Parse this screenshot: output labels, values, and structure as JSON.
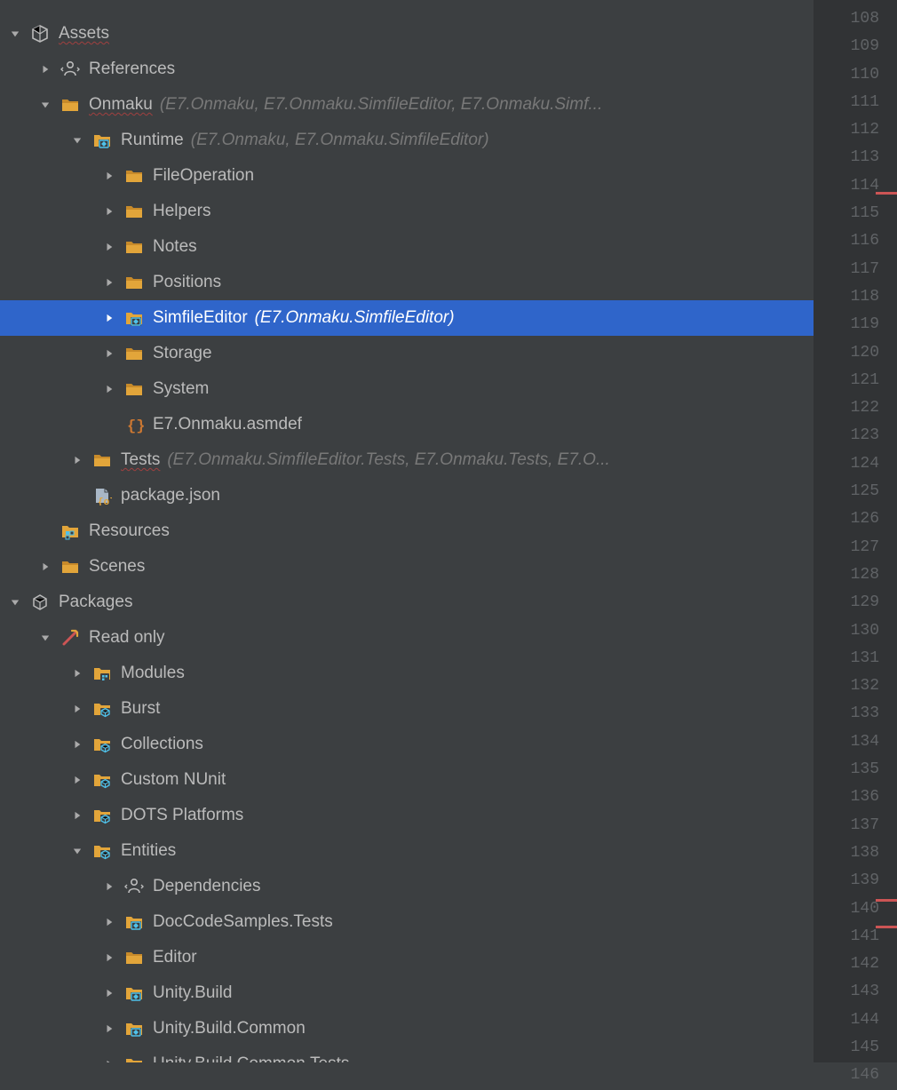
{
  "gutter": {
    "start": 108,
    "end": 146,
    "marks": [
      216,
      1012,
      1042
    ]
  },
  "tree": [
    {
      "indent": 0,
      "arrow": "expanded",
      "icon": "unity",
      "label": "Assets",
      "labelStyle": "excluded",
      "hint": ""
    },
    {
      "indent": 1,
      "arrow": "collapsed",
      "icon": "references",
      "label": "References",
      "hint": ""
    },
    {
      "indent": 1,
      "arrow": "expanded",
      "icon": "folder",
      "label": "Onmaku",
      "labelStyle": "excluded",
      "hint": "(E7.Onmaku, E7.Onmaku.SimfileEditor, E7.Onmaku.Simf..."
    },
    {
      "indent": 2,
      "arrow": "expanded",
      "icon": "folder-asm",
      "label": "Runtime",
      "hint": "(E7.Onmaku, E7.Onmaku.SimfileEditor)"
    },
    {
      "indent": 3,
      "arrow": "collapsed",
      "icon": "folder",
      "label": "FileOperation",
      "hint": ""
    },
    {
      "indent": 3,
      "arrow": "collapsed",
      "icon": "folder",
      "label": "Helpers",
      "hint": ""
    },
    {
      "indent": 3,
      "arrow": "collapsed",
      "icon": "folder",
      "label": "Notes",
      "hint": ""
    },
    {
      "indent": 3,
      "arrow": "collapsed",
      "icon": "folder",
      "label": "Positions",
      "hint": ""
    },
    {
      "indent": 3,
      "arrow": "collapsed",
      "icon": "folder-asm",
      "label": "SimfileEditor",
      "hint": "(E7.Onmaku.SimfileEditor)",
      "selected": true
    },
    {
      "indent": 3,
      "arrow": "collapsed",
      "icon": "folder",
      "label": "Storage",
      "hint": ""
    },
    {
      "indent": 3,
      "arrow": "collapsed",
      "icon": "folder",
      "label": "System",
      "hint": ""
    },
    {
      "indent": 3,
      "arrow": "blank",
      "icon": "asmdef",
      "label": "E7.Onmaku.asmdef",
      "hint": ""
    },
    {
      "indent": 2,
      "arrow": "collapsed",
      "icon": "folder",
      "label": "Tests",
      "labelStyle": "excluded",
      "hint": "(E7.Onmaku.SimfileEditor.Tests, E7.Onmaku.Tests, E7.O..."
    },
    {
      "indent": 2,
      "arrow": "blank",
      "icon": "json",
      "label": "package.json",
      "hint": ""
    },
    {
      "indent": 1,
      "arrow": "blank",
      "icon": "resources",
      "label": "Resources",
      "hint": ""
    },
    {
      "indent": 1,
      "arrow": "collapsed",
      "icon": "folder",
      "label": "Scenes",
      "hint": ""
    },
    {
      "indent": 0,
      "arrow": "expanded",
      "icon": "package-root",
      "label": "Packages",
      "hint": ""
    },
    {
      "indent": 1,
      "arrow": "expanded",
      "icon": "readonly",
      "label": "Read only",
      "hint": ""
    },
    {
      "indent": 2,
      "arrow": "collapsed",
      "icon": "folder-pkg",
      "label": "Modules",
      "hint": ""
    },
    {
      "indent": 2,
      "arrow": "collapsed",
      "icon": "folder-pkg-b",
      "label": "Burst",
      "hint": ""
    },
    {
      "indent": 2,
      "arrow": "collapsed",
      "icon": "folder-pkg-b",
      "label": "Collections",
      "hint": ""
    },
    {
      "indent": 2,
      "arrow": "collapsed",
      "icon": "folder-pkg-b",
      "label": "Custom NUnit",
      "hint": ""
    },
    {
      "indent": 2,
      "arrow": "collapsed",
      "icon": "folder-pkg-b",
      "label": "DOTS Platforms",
      "hint": ""
    },
    {
      "indent": 2,
      "arrow": "expanded",
      "icon": "folder-pkg-b",
      "label": "Entities",
      "hint": ""
    },
    {
      "indent": 3,
      "arrow": "collapsed",
      "icon": "references",
      "label": "Dependencies",
      "hint": ""
    },
    {
      "indent": 3,
      "arrow": "collapsed",
      "icon": "folder-asm",
      "label": "DocCodeSamples.Tests",
      "hint": ""
    },
    {
      "indent": 3,
      "arrow": "collapsed",
      "icon": "folder",
      "label": "Editor",
      "hint": ""
    },
    {
      "indent": 3,
      "arrow": "collapsed",
      "icon": "folder-asm",
      "label": "Unity.Build",
      "hint": ""
    },
    {
      "indent": 3,
      "arrow": "collapsed",
      "icon": "folder-asm",
      "label": "Unity.Build.Common",
      "hint": ""
    },
    {
      "indent": 3,
      "arrow": "collapsed",
      "icon": "folder-asm",
      "label": "Unity.Build.Common.Tests",
      "hint": ""
    }
  ]
}
